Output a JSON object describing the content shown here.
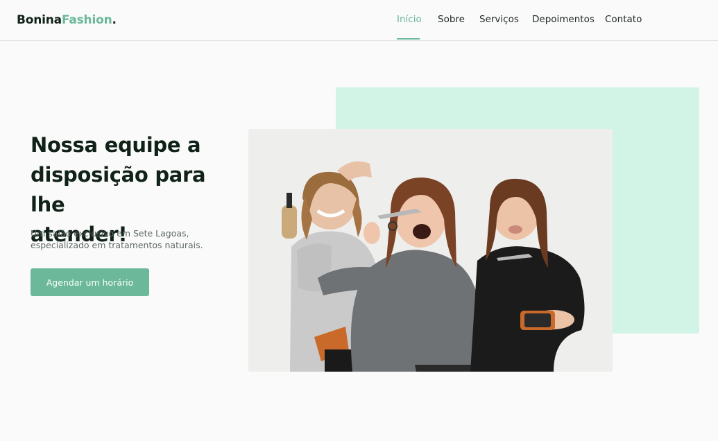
{
  "brand": {
    "part1": "Bonina",
    "part2": "Fashion",
    "part3": "."
  },
  "nav": {
    "items": [
      {
        "label": "Início",
        "active": true
      },
      {
        "label": "Sobre",
        "active": false
      },
      {
        "label": "Serviços",
        "active": false
      },
      {
        "label": "Depoimentos",
        "active": false
      },
      {
        "label": "Contato",
        "active": false
      }
    ]
  },
  "hero": {
    "title_line1": "Nossa equipe a",
    "title_line2": "disposição para lhe",
    "title_line3": "atender!",
    "subtitle": "Um salão exclusivo em Sete Lagoas, especializado em tratamentos naturais.",
    "cta_label": "Agendar um horário"
  },
  "colors": {
    "accent": "#6bb89a",
    "mint": "#d1f4e6",
    "text_dark": "#102218"
  }
}
